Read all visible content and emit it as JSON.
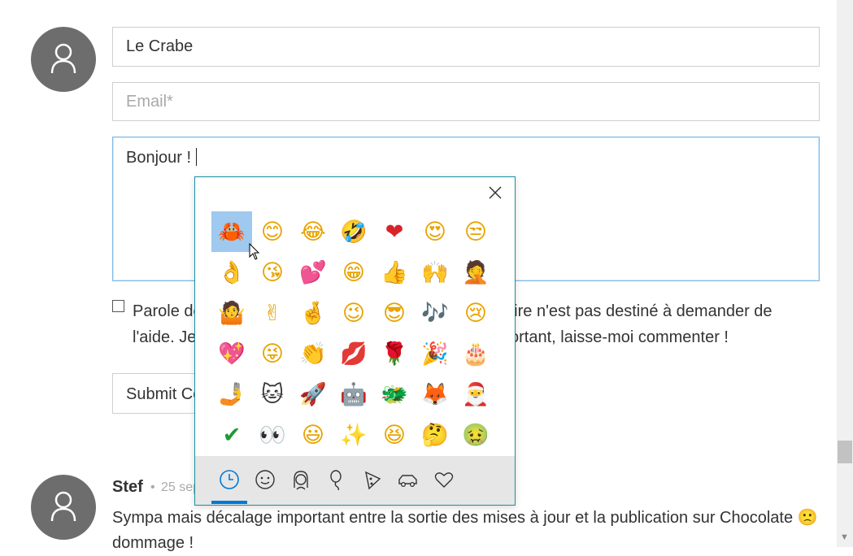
{
  "form": {
    "name_value": "Le Crabe",
    "email_placeholder": "Email*",
    "comment_value": "Bonjour !",
    "consent_text": "Parole de développeur, je comprends que ce formulaire n'est pas destiné à demander de l'aide. Je sais qu'il s'agit d'un sujet suffisamment important, laisse-moi commenter !",
    "submit_label": "Submit Comment"
  },
  "comment": {
    "author": "Stef",
    "separator": "•",
    "date": "25 sept.",
    "text": "Sympa mais décalage important entre la sortie des mises à jour et la publication sur Chocolate 🙁 dommage !"
  },
  "emoji_panel": {
    "selected_index": 0,
    "emojis": [
      "🦀",
      "😊",
      "😂",
      "🤣",
      "❤",
      "😍",
      "😒",
      "👌",
      "😘",
      "💕",
      "😁",
      "👍",
      "🙌",
      "🤦",
      "🤷",
      "✌",
      "🤞",
      "😉",
      "😎",
      "🎶",
      "😢",
      "💖",
      "😜",
      "👏",
      "💋",
      "🌹",
      "🎉",
      "🎂",
      "🤳",
      "🐱",
      "🚀",
      "🤖",
      "🐲",
      "🦊",
      "🎅",
      "✔",
      "👀",
      "😃",
      "✨",
      "😆",
      "🤔",
      "🤢"
    ],
    "tabs": [
      "recent-icon",
      "smiley-icon",
      "people-icon",
      "celebration-icon",
      "food-icon",
      "travel-icon",
      "heart-icon"
    ]
  },
  "colors": {
    "avatar": "#6d6d6d",
    "panel_border": "#1b8fa3",
    "selection": "#9fc9ee",
    "tab_active": "#0078d7"
  }
}
